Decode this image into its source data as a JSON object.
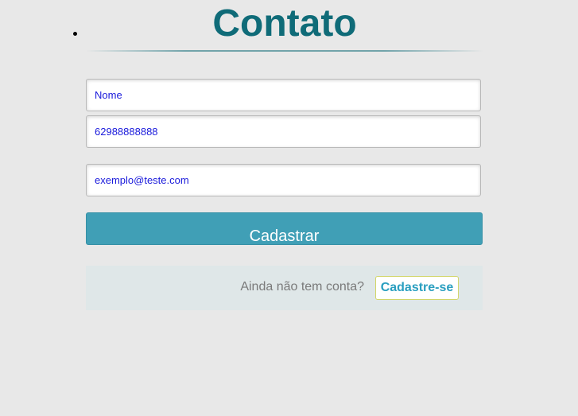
{
  "header": {
    "title": "Contato"
  },
  "form": {
    "name_field": {
      "placeholder": "Nome",
      "value": ""
    },
    "phone_field": {
      "placeholder": "62988888888",
      "value": ""
    },
    "email_field": {
      "placeholder": "exemplo@teste.com",
      "value": ""
    },
    "submit_label": "Cadastrar"
  },
  "signup": {
    "prompt": "Ainda não tem conta?",
    "link_label": "Cadastre-se"
  },
  "colors": {
    "background": "#e8e8e8",
    "title": "#0f6b78",
    "submit_button": "#409fb6",
    "link": "#2a9fc0",
    "input_text": "#1a1adb"
  }
}
